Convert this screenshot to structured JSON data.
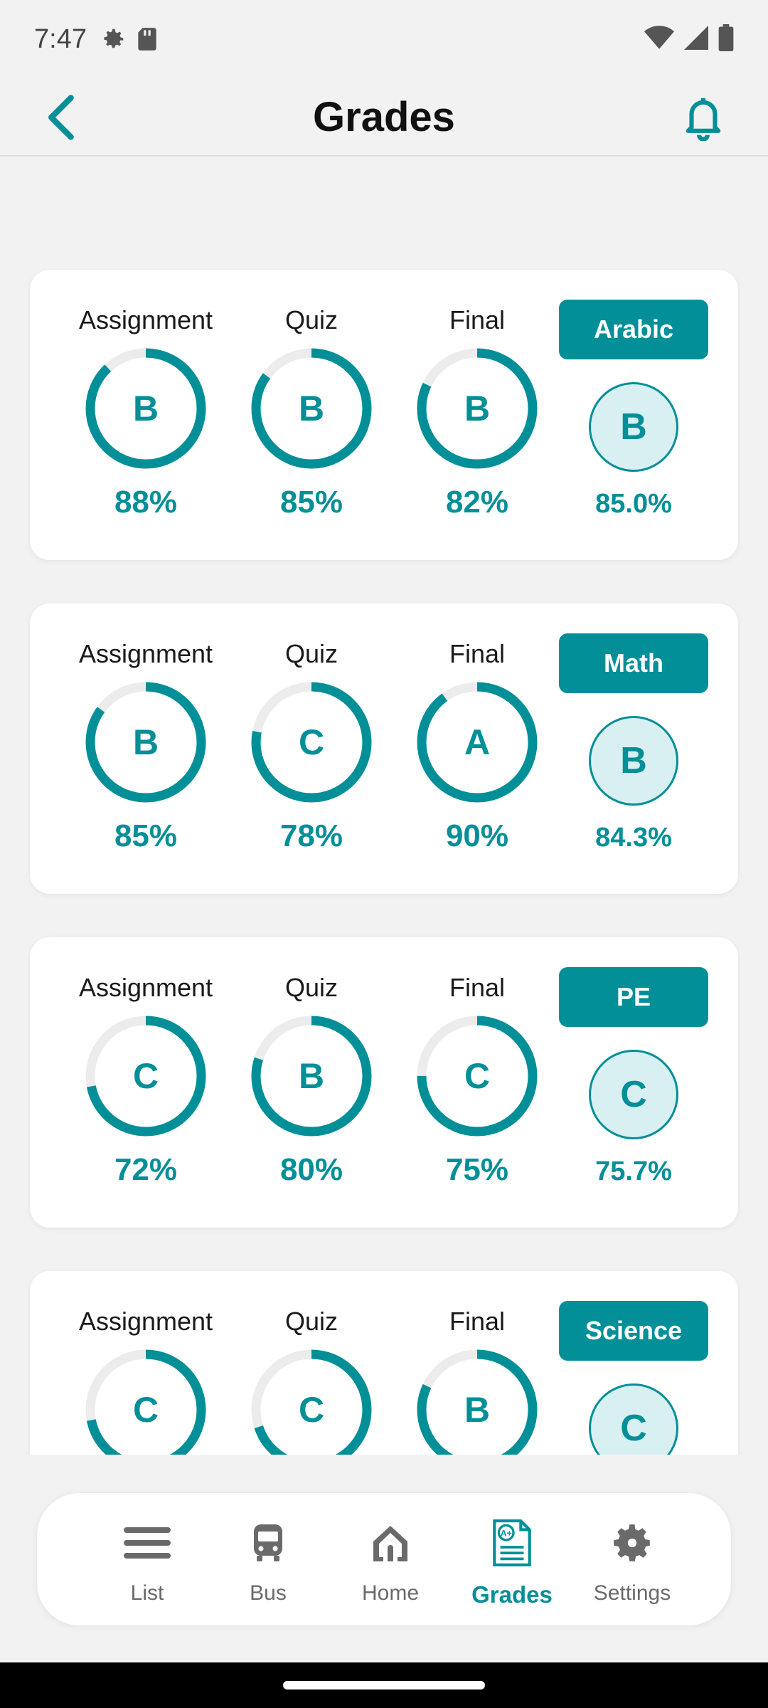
{
  "status_bar": {
    "time": "7:47"
  },
  "header": {
    "title": "Grades"
  },
  "labels": {
    "assignment": "Assignment",
    "quiz": "Quiz",
    "final": "Final"
  },
  "subjects": [
    {
      "name": "Arabic",
      "assignment": {
        "grade": "B",
        "percent": "88%",
        "value": 88
      },
      "quiz": {
        "grade": "B",
        "percent": "85%",
        "value": 85
      },
      "final": {
        "grade": "B",
        "percent": "82%",
        "value": 82
      },
      "average": {
        "grade": "B",
        "percent": "85.0%"
      }
    },
    {
      "name": "Math",
      "assignment": {
        "grade": "B",
        "percent": "85%",
        "value": 85
      },
      "quiz": {
        "grade": "C",
        "percent": "78%",
        "value": 78
      },
      "final": {
        "grade": "A",
        "percent": "90%",
        "value": 90
      },
      "average": {
        "grade": "B",
        "percent": "84.3%"
      }
    },
    {
      "name": "PE",
      "assignment": {
        "grade": "C",
        "percent": "72%",
        "value": 72
      },
      "quiz": {
        "grade": "B",
        "percent": "80%",
        "value": 80
      },
      "final": {
        "grade": "C",
        "percent": "75%",
        "value": 75
      },
      "average": {
        "grade": "C",
        "percent": "75.7%"
      }
    },
    {
      "name": "Science",
      "assignment": {
        "grade": "C",
        "percent": "",
        "value": 72
      },
      "quiz": {
        "grade": "C",
        "percent": "",
        "value": 70
      },
      "final": {
        "grade": "B",
        "percent": "",
        "value": 82
      },
      "average": {
        "grade": "C",
        "percent": ""
      }
    }
  ],
  "bottom_nav": {
    "items": [
      {
        "label": "List",
        "icon": "list-icon"
      },
      {
        "label": "Bus",
        "icon": "bus-icon"
      },
      {
        "label": "Home",
        "icon": "home-icon"
      },
      {
        "label": "Grades",
        "icon": "grades-icon",
        "active": true
      },
      {
        "label": "Settings",
        "icon": "settings-icon"
      }
    ]
  },
  "colors": {
    "accent": "#028f98",
    "track": "#ececec",
    "avg_fill": "#d9f0f2"
  }
}
